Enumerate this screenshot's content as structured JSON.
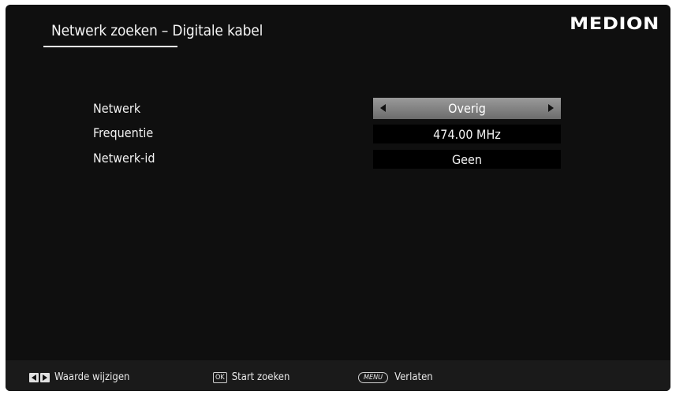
{
  "header": {
    "title": "Netwerk zoeken – Digitale kabel",
    "logo": "MEDION"
  },
  "settings": [
    {
      "label": "Netwerk",
      "value": "Overig",
      "selected": true
    },
    {
      "label": "Frequentie",
      "value": "474.00 MHz",
      "selected": false
    },
    {
      "label": "Netwerk-id",
      "value": "Geen",
      "selected": false
    }
  ],
  "footer": {
    "change_value": {
      "icon": "left-right-arrow-keys-icon",
      "label": "Waarde wijzigen"
    },
    "start_search": {
      "key": "OK",
      "label": "Start zoeken"
    },
    "exit": {
      "key": "MENU",
      "label": "Verlaten"
    }
  },
  "colors": {
    "background": "#0f0f0f",
    "selected_row": "#8a8a8a",
    "value_box": "#000000",
    "footer": "#1a1a1a"
  }
}
